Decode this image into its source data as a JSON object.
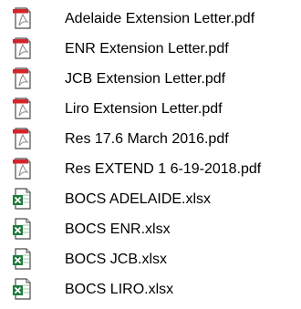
{
  "files": [
    {
      "name": "Adelaide Extension Letter.pdf",
      "icon": "pdf-icon"
    },
    {
      "name": "ENR Extension Letter.pdf",
      "icon": "pdf-icon"
    },
    {
      "name": "JCB Extension Letter.pdf",
      "icon": "pdf-icon"
    },
    {
      "name": "Liro Extension Letter.pdf",
      "icon": "pdf-icon"
    },
    {
      "name": "Res 17.6 March 2016.pdf",
      "icon": "pdf-icon"
    },
    {
      "name": "Res EXTEND 1 6-19-2018.pdf",
      "icon": "pdf-icon"
    },
    {
      "name": "BOCS ADELAIDE.xlsx",
      "icon": "excel-icon"
    },
    {
      "name": "BOCS ENR.xlsx",
      "icon": "excel-icon"
    },
    {
      "name": "BOCS JCB.xlsx",
      "icon": "excel-icon"
    },
    {
      "name": "BOCS LIRO.xlsx",
      "icon": "excel-icon"
    }
  ],
  "colors": {
    "pdf_red": "#d4252b",
    "excel_green": "#1e7b3d",
    "text": "#000000"
  }
}
